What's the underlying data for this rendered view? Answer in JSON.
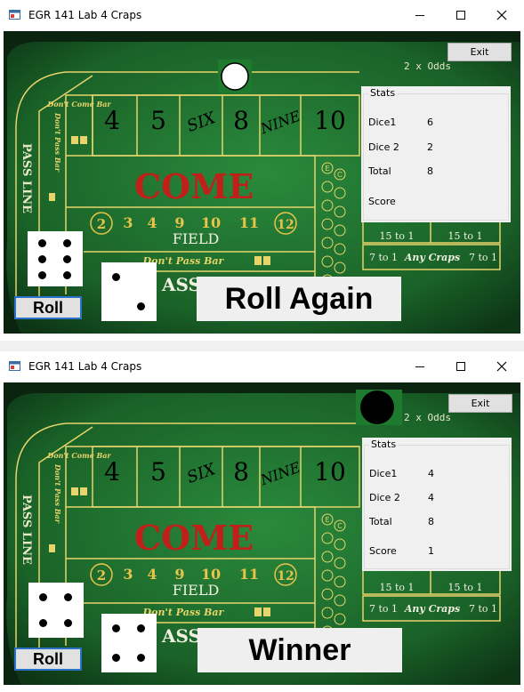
{
  "windows": [
    {
      "title": "EGR 141 Lab 4 Craps",
      "exit_label": "Exit",
      "odds_label": "2 x Odds",
      "stats": {
        "group_label": "Stats",
        "dice1_label": "Dice1",
        "dice1_value": "6",
        "dice2_label": "Dice 2",
        "dice2_value": "2",
        "total_label": "Total",
        "total_value": "8",
        "score_label": "Score",
        "score_value": ""
      },
      "puck": "on",
      "die1": 6,
      "die2": 2,
      "roll_label": "Roll",
      "message": "Roll Again"
    },
    {
      "title": "EGR 141 Lab 4 Craps",
      "exit_label": "Exit",
      "odds_label": "2 x Odds",
      "stats": {
        "group_label": "Stats",
        "dice1_label": "Dice1",
        "dice1_value": "4",
        "dice2_label": "Dice 2",
        "dice2_value": "4",
        "total_label": "Total",
        "total_value": "8",
        "score_label": "Score",
        "score_value": "1"
      },
      "puck": "off",
      "die1": 4,
      "die2": 4,
      "roll_label": "Roll",
      "message": "Winner"
    }
  ],
  "table_text": {
    "place_numbers": [
      "4",
      "5",
      "SIX",
      "8",
      "NINE",
      "10"
    ],
    "dont_come_bar": "Don't Come Bar",
    "dont_pass_bar_side": "Don't Pass Bar",
    "pass_line": "PASS LINE",
    "come": "COME",
    "field": "FIELD",
    "field_numbers": [
      "2",
      "3",
      "4",
      "9",
      "10",
      "11",
      "12"
    ],
    "dont_pass_bar": "Don't Pass Bar",
    "pass_fragment": "ASS",
    "odds_15a": "15 to 1",
    "odds_15b": "15 to 1",
    "odds_7a": "7 to 1",
    "any_craps": "Any Craps",
    "odds_7b": "7 to 1",
    "e_letter": "E",
    "c_letter": "C"
  },
  "icons": {
    "app_icon": "app-window-icon",
    "minimize": "minimize-icon",
    "maximize": "maximize-icon",
    "close": "close-icon"
  },
  "colors": {
    "felt": "#1e6b2c",
    "felt_dark": "#0b2410",
    "table_line": "#e7d46a",
    "come_red": "#c0201a",
    "field_gold": "#e7c44a",
    "message_bg": "#efefef",
    "button_border": "#2a72c8"
  }
}
